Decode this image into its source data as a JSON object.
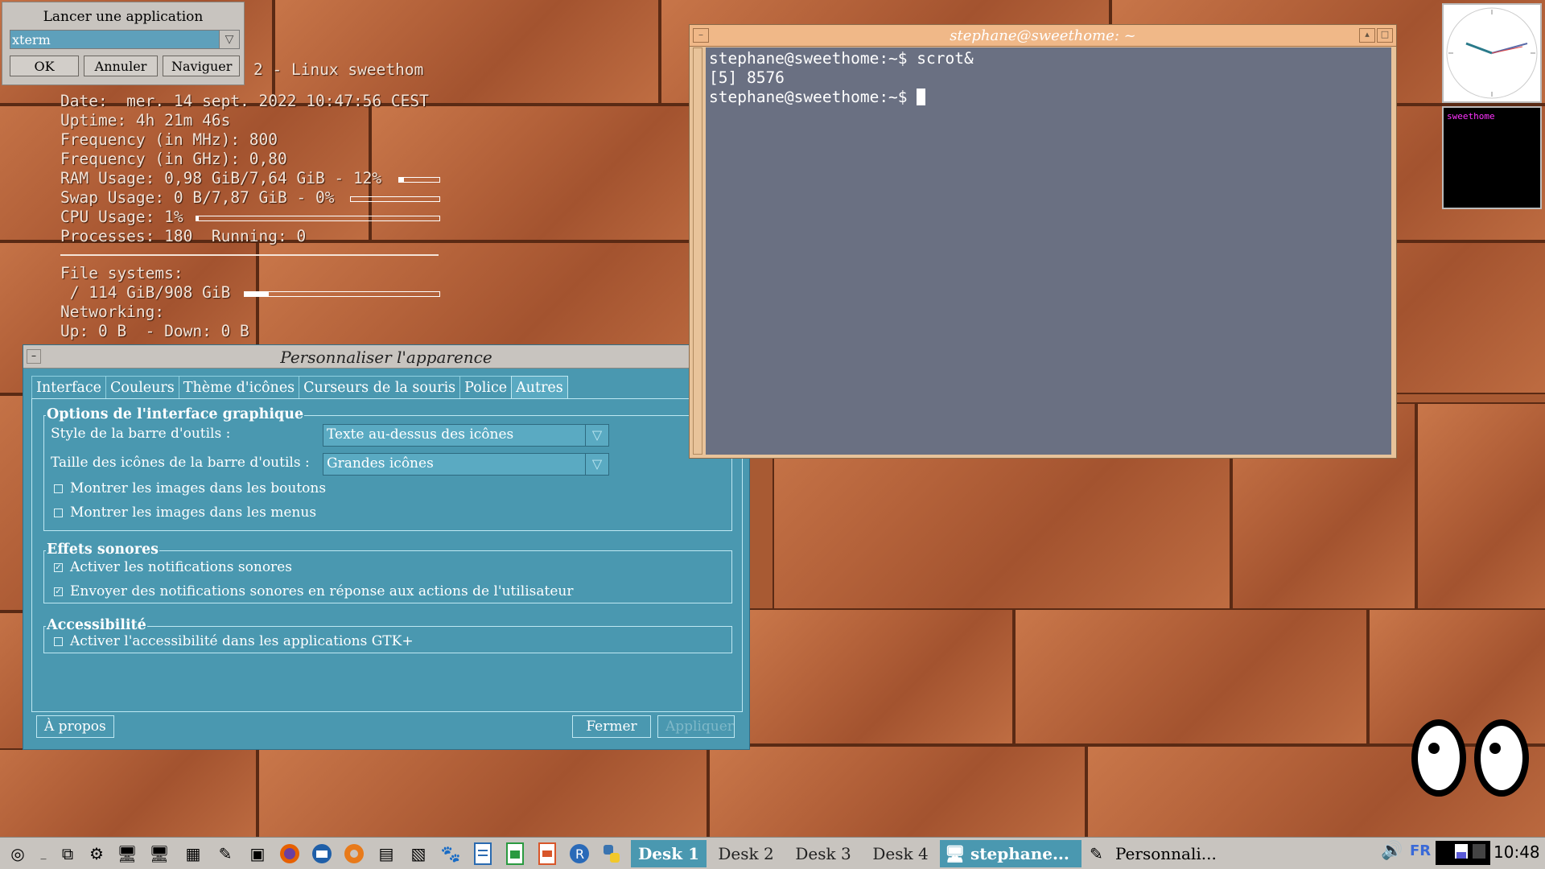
{
  "launcher": {
    "title": "Lancer une application",
    "input_value": "xterm",
    "ok": "OK",
    "cancel": "Annuler",
    "browse": "Naviguer"
  },
  "conky": {
    "header": "2 - Linux sweethom",
    "date": "Date:  mer. 14 sept. 2022 10:47:56 CEST",
    "uptime": "Uptime: 4h 21m 46s",
    "freq_mhz": "Frequency (in MHz): 800",
    "freq_ghz": "Frequency (in GHz): 0,80",
    "ram": "RAM Usage: 0,98 GiB/7,64 GiB - 12%",
    "ram_pct": 12,
    "swap": "Swap Usage: 0 B/7,87 GiB - 0%",
    "swap_pct": 0,
    "cpu": "CPU Usage: 1%",
    "cpu_pct": 1,
    "processes": "Processes: 180  Running: 0",
    "fs_title": "File systems:",
    "fs_root": " / 114 GiB/908 GiB",
    "fs_pct": 12.5,
    "net_title": "Networking:",
    "net": "Up: 0 B  - Down: 0 B"
  },
  "xterm": {
    "title": "stephane@sweethome: ~",
    "lines": [
      "stephane@sweethome:~$ scrot&",
      "[5] 8576",
      "stephane@sweethome:~$ "
    ]
  },
  "dialog": {
    "title": "Personnaliser l'apparence",
    "tabs": [
      "Interface",
      "Couleurs",
      "Thème d'icônes",
      "Curseurs de la souris",
      "Police",
      "Autres"
    ],
    "active_tab": "Autres",
    "group_gui": "Options de l'interface graphique",
    "toolbar_style_label": "Style de la barre d'outils :",
    "toolbar_style_value": "Texte au-dessus des icônes",
    "toolbar_size_label": "Taille des icônes de la barre d'outils :",
    "toolbar_size_value": "Grandes icônes",
    "chk_button_images": "Montrer les images dans les boutons",
    "chk_menu_images": "Montrer les images dans les menus",
    "group_sound": "Effets sonores",
    "chk_sound_notif": "Activer les notifications sonores",
    "chk_sound_actions": "Envoyer des notifications sonores en réponse aux actions de l'utilisateur",
    "group_access": "Accessibilité",
    "chk_access": "Activer l'accessibilité dans les applications GTK+",
    "about": "À propos",
    "close": "Fermer",
    "apply": "Appliquer"
  },
  "pager_label": "sweethome",
  "taskbar": {
    "desks": [
      "Desk 1",
      "Desk 2",
      "Desk 3",
      "Desk 4"
    ],
    "tasks": [
      "stephane...",
      "Personnali..."
    ],
    "lang": "FR",
    "time": "10:48"
  },
  "icons": [
    "menu-icon",
    "minimize-all-icon",
    "windows-icon",
    "settings-icon",
    "computer-icon",
    "monitor-icon",
    "calculator-icon",
    "editor-icon",
    "terminal-icon",
    "firefox-icon",
    "thunderbird-icon",
    "lifebuoy-icon",
    "notes-icon",
    "screenshot-icon",
    "gimp-icon",
    "writer-icon",
    "calc-icon",
    "impress-icon",
    "r-icon",
    "python-icon"
  ]
}
